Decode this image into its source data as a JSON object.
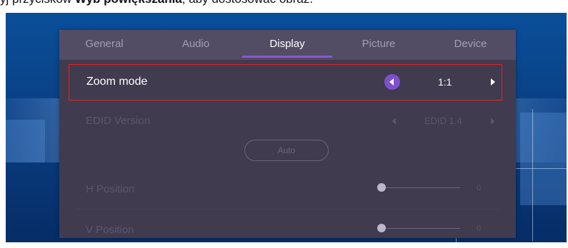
{
  "caption": {
    "prefix": "yj przycisków ",
    "bold": "Wyb powiększania",
    "suffix": ", aby dostosować obraz."
  },
  "tabs": [
    {
      "label": "General"
    },
    {
      "label": "Audio"
    },
    {
      "label": "Display",
      "active": true
    },
    {
      "label": "Picture"
    },
    {
      "label": "Device"
    }
  ],
  "settings": {
    "zoom_mode": {
      "label": "Zoom mode",
      "value": "1:1"
    },
    "edid_version": {
      "label": "EDID Version",
      "value": "EDID 1.4"
    },
    "auto_button": {
      "label": "Auto"
    },
    "h_position": {
      "label": "H Position",
      "value": "0",
      "level": 0
    },
    "v_position": {
      "label": "V Position",
      "value": "0",
      "level": 0
    }
  },
  "colors": {
    "panel_bg": "#403b4e",
    "tab_bar_bg": "#524c64",
    "accent": "#8a56d0",
    "highlight_border": "#e5252a",
    "disabled_text": "#5c5670"
  },
  "icons": [
    "left-arrow-circle-icon",
    "right-arrow-icon",
    "slider-knob"
  ]
}
